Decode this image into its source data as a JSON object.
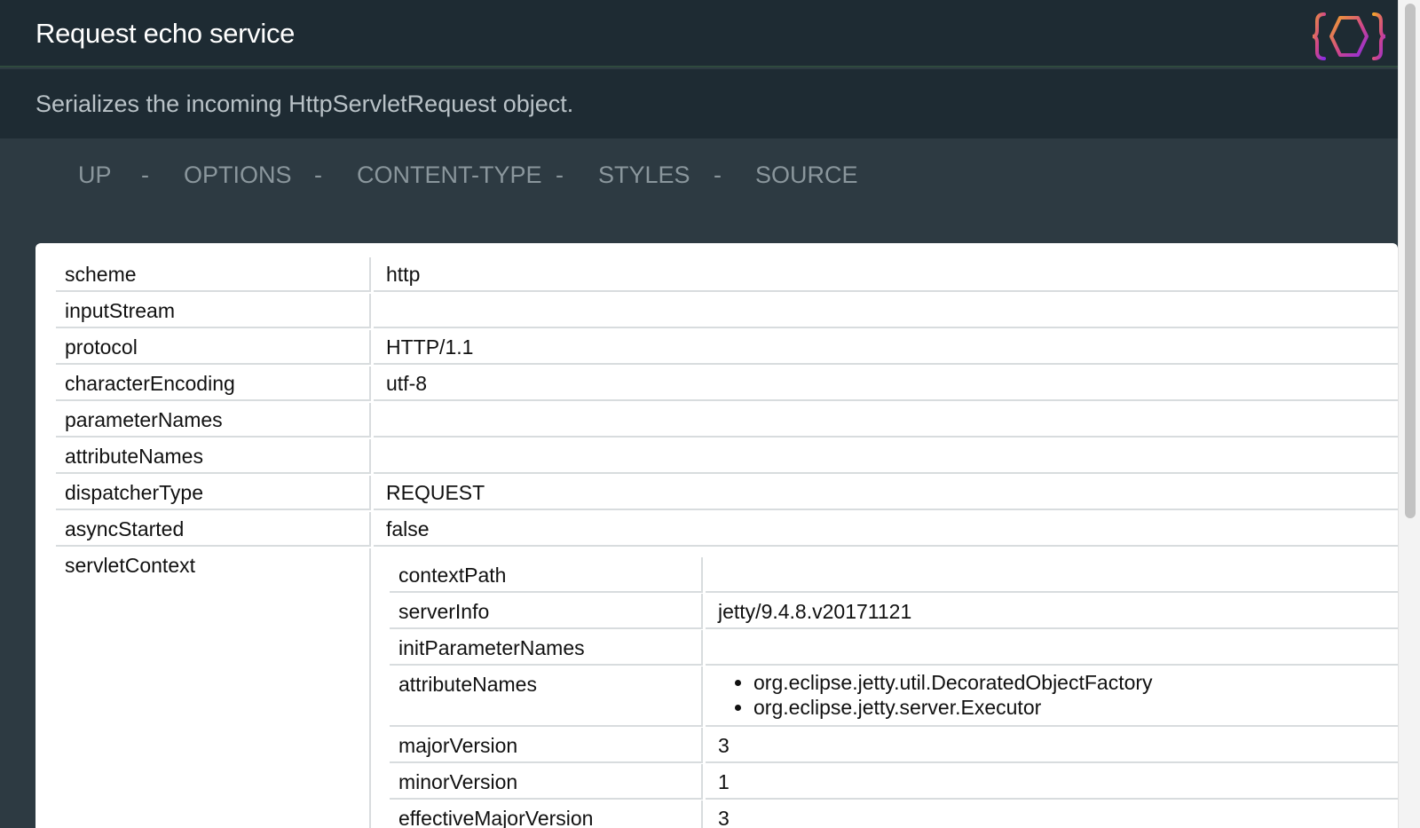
{
  "header": {
    "title": "Request echo service",
    "description": "Serializes the incoming HttpServletRequest object.",
    "logo_icon": "hexagon-braces-logo-icon"
  },
  "nav": {
    "items": [
      "UP",
      "OPTIONS",
      "CONTENT-TYPE",
      "STYLES",
      "SOURCE"
    ],
    "separator": "-"
  },
  "request": {
    "rows": [
      {
        "key": "scheme",
        "value": "http"
      },
      {
        "key": "inputStream",
        "value": ""
      },
      {
        "key": "protocol",
        "value": "HTTP/1.1"
      },
      {
        "key": "characterEncoding",
        "value": "utf-8"
      },
      {
        "key": "parameterNames",
        "value": ""
      },
      {
        "key": "attributeNames",
        "value": ""
      },
      {
        "key": "dispatcherType",
        "value": "REQUEST"
      },
      {
        "key": "asyncStarted",
        "value": "false"
      }
    ],
    "servletContext": {
      "key": "servletContext",
      "rows": [
        {
          "key": "contextPath",
          "value": ""
        },
        {
          "key": "serverInfo",
          "value": "jetty/9.4.8.v20171121"
        },
        {
          "key": "initParameterNames",
          "value": ""
        },
        {
          "key": "attributeNames",
          "list": [
            "org.eclipse.jetty.util.DecoratedObjectFactory",
            "org.eclipse.jetty.server.Executor"
          ]
        },
        {
          "key": "majorVersion",
          "value": "3"
        },
        {
          "key": "minorVersion",
          "value": "1"
        },
        {
          "key": "effectiveMajorVersion",
          "value": "3"
        }
      ]
    }
  },
  "colors": {
    "header_bg": "#1e2b33",
    "page_bg": "#2d3a42",
    "logo_orange": "#f2a22c",
    "logo_purple": "#9b2fd6"
  }
}
